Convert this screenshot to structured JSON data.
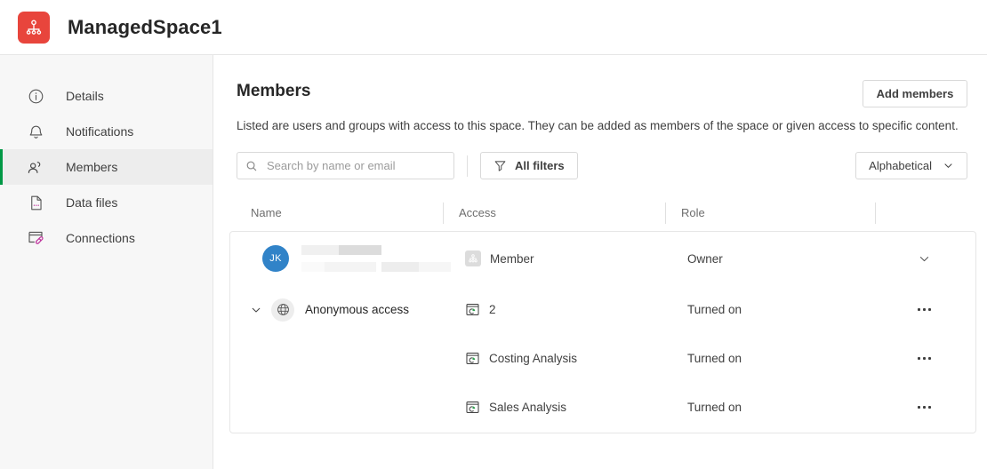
{
  "header": {
    "logo_icon": "space-hierarchy-icon",
    "logo_color": "#e8453c",
    "title": "ManagedSpace1"
  },
  "sidebar": {
    "active_index": 2,
    "accent_color": "#009845",
    "items": [
      {
        "label": "Details",
        "icon": "info-circle-icon"
      },
      {
        "label": "Notifications",
        "icon": "bell-icon"
      },
      {
        "label": "Members",
        "icon": "people-icon"
      },
      {
        "label": "Data files",
        "icon": "file-icon"
      },
      {
        "label": "Connections",
        "icon": "connections-icon"
      }
    ]
  },
  "main": {
    "title": "Members",
    "description": "Listed are users and groups with access to this space. They can be added as members of the space or given access to specific content.",
    "add_members_label": "Add members",
    "search": {
      "placeholder": "Search by name or email",
      "value": "",
      "icon": "search-icon"
    },
    "filters_label": "All filters",
    "filters_icon": "funnel-icon",
    "sort_label": "Alphabetical",
    "sort_icon": "chevron-down-icon",
    "columns": [
      "Name",
      "Access",
      "Role",
      ""
    ],
    "rows": [
      {
        "type": "user",
        "avatar_initials": "JK",
        "avatar_color": "#3183c8",
        "name_redacted": true,
        "access": "Member",
        "access_icon": "member-badge-icon",
        "role": "Owner",
        "action_icon": "chevron-down-icon"
      },
      {
        "type": "group",
        "expanded": true,
        "toggle_icon": "chevron-down-icon",
        "name": "Anonymous access",
        "name_icon": "globe-icon",
        "access": "2",
        "access_icon": "app-chart-icon",
        "role": "Turned on",
        "action_icon": "kebab-menu-icon"
      },
      {
        "type": "child",
        "name": "",
        "access": "Costing Analysis",
        "access_icon": "app-chart-icon",
        "role": "Turned on",
        "action_icon": "kebab-menu-icon"
      },
      {
        "type": "child",
        "name": "",
        "access": "Sales Analysis",
        "access_icon": "app-chart-icon",
        "role": "Turned on",
        "action_icon": "kebab-menu-icon"
      }
    ]
  }
}
